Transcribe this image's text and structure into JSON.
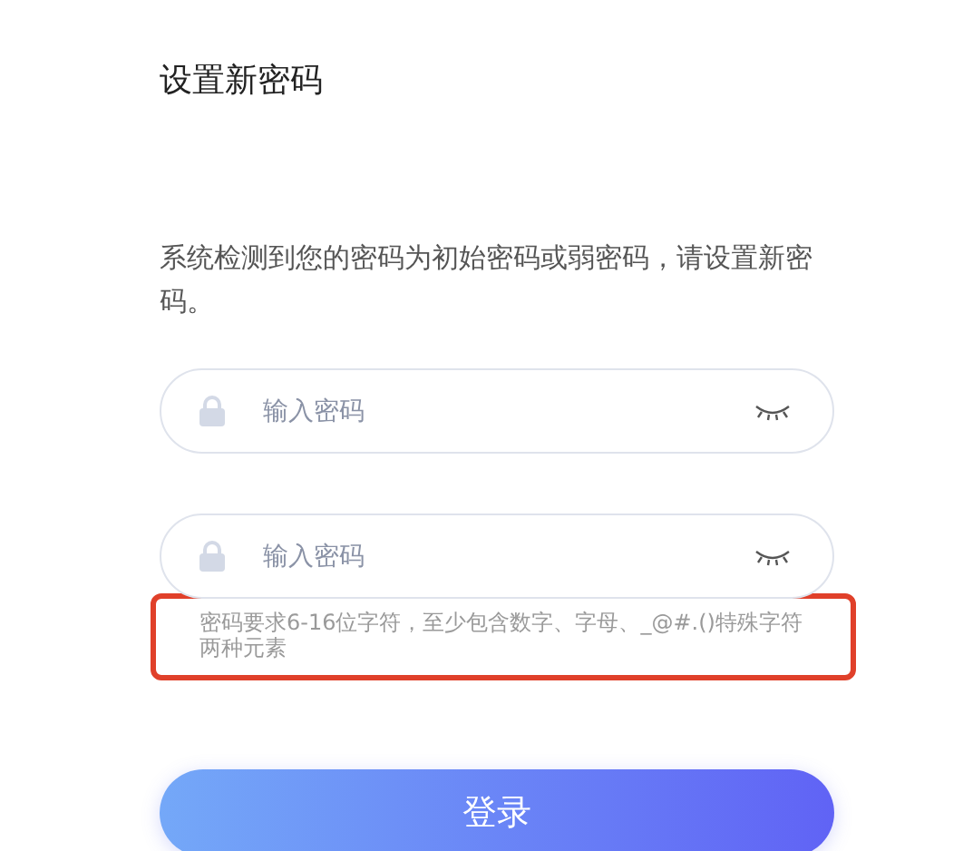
{
  "title": "设置新密码",
  "notice": "系统检测到您的密码为初始密码或弱密码，请设置新密码。",
  "fields": [
    {
      "placeholder": "输入密码"
    },
    {
      "placeholder": "输入密码"
    }
  ],
  "hint": "密码要求6-16位字符，至少包含数字、字母、_@#.()特殊字符两种元素",
  "submit": "登录"
}
